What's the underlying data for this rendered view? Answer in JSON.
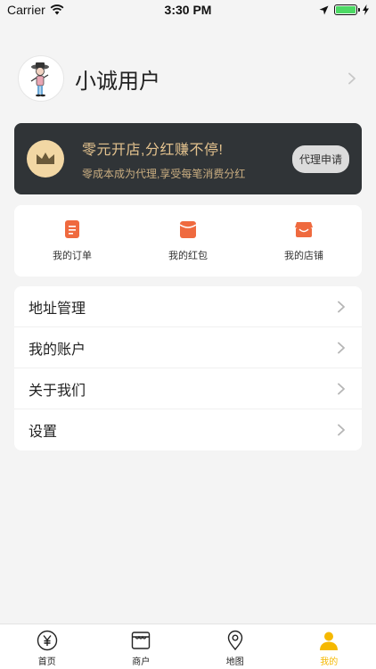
{
  "status_bar": {
    "carrier": "Carrier",
    "time": "3:30 PM"
  },
  "profile": {
    "username": "小诚用户"
  },
  "banner": {
    "title": "零元开店,分红赚不停!",
    "subtitle": "零成本成为代理,享受每笔消费分红",
    "button_label": "代理申请"
  },
  "quick_actions": [
    {
      "label": "我的订单",
      "icon": "order-icon"
    },
    {
      "label": "我的红包",
      "icon": "red-packet-icon"
    },
    {
      "label": "我的店铺",
      "icon": "shop-icon"
    }
  ],
  "menu": [
    {
      "label": "地址管理"
    },
    {
      "label": "我的账户"
    },
    {
      "label": "关于我们"
    },
    {
      "label": "设置"
    }
  ],
  "tabbar": [
    {
      "label": "首页",
      "icon": "yen-icon",
      "active": false
    },
    {
      "label": "商户",
      "icon": "storefront-icon",
      "active": false
    },
    {
      "label": "地图",
      "icon": "location-pin-icon",
      "active": false
    },
    {
      "label": "我的",
      "icon": "person-icon",
      "active": true
    }
  ],
  "colors": {
    "accent": "#f5b800",
    "banner_bg": "#303437",
    "banner_gold": "#e3c28e",
    "quick_icon": "#ef6a3f"
  }
}
